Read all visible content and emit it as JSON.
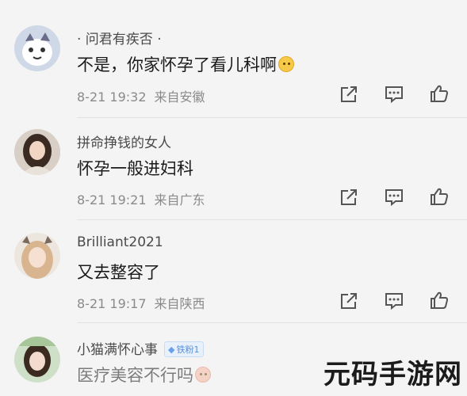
{
  "comments": [
    {
      "username": "· 问君有疾否 ·",
      "text": "不是，你家怀孕了看儿科啊",
      "date": "8-21 19:32",
      "location": "来自安徽",
      "emoji": "tired-face"
    },
    {
      "username": "拼命挣钱的女人",
      "text": "怀孕一般进妇科",
      "date": "8-21 19:21",
      "location": "来自广东"
    },
    {
      "username": "Brilliant2021",
      "text": "又去整容了",
      "date": "8-21 19:17",
      "location": "来自陕西"
    },
    {
      "username": "小猫满怀心事",
      "badge": "铁粉1",
      "text": "医疗美容不行吗",
      "emoji": "flushed-face"
    }
  ],
  "icons": [
    "share-icon",
    "comment-icon",
    "like-icon"
  ],
  "watermark": "元码手游网"
}
